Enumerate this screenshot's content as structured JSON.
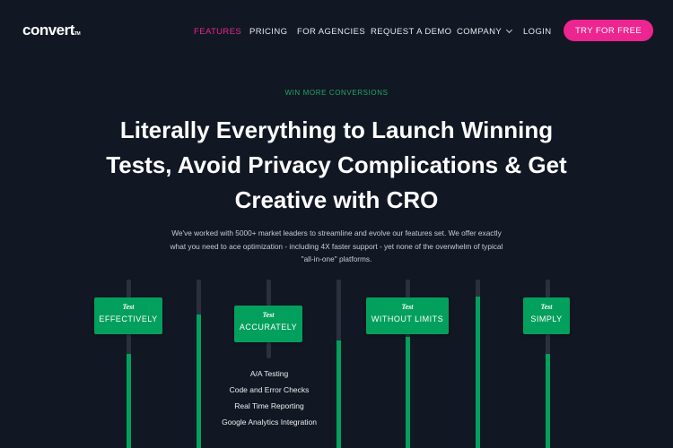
{
  "header": {
    "logo": "convert",
    "logo_tm": "TM",
    "nav": [
      "FEATURES",
      "PRICING",
      "FOR AGENCIES",
      "REQUEST A DEMO",
      "COMPANY",
      "LOGIN"
    ],
    "active": "FEATURES",
    "cta": "TRY FOR FREE"
  },
  "hero": {
    "eyebrow": "WIN MORE CONVERSIONS",
    "title_lines": [
      "Literally Everything to Launch Winning",
      "Tests, Avoid Privacy Complications & Get",
      "Creative with CRO"
    ],
    "subtitle_lines": [
      "We've worked with 5000+ market leaders to streamline and evolve our features set. We offer exactly",
      "what you need to ace optimization - including 4X faster support - yet none of the overwhelm of typical",
      "\"all-in-one\" platforms."
    ]
  },
  "cards": [
    {
      "prefix": "Test",
      "label": "EFFECTIVELY"
    },
    {
      "prefix": "Test",
      "label": "ACCURATELY"
    },
    {
      "prefix": "Test",
      "label": "WITHOUT LIMITS"
    },
    {
      "prefix": "Test",
      "label": "SIMPLY"
    }
  ],
  "accurately_features": [
    "A/A Testing",
    "Code and Error Checks",
    "Real Time Reporting",
    "Google Analytics Integration"
  ],
  "bar_fill_percent": [
    56,
    79,
    0,
    64,
    66,
    90,
    56
  ],
  "colors": {
    "accent": "#ec2590",
    "green": "#03a05d",
    "background": "#111723"
  }
}
